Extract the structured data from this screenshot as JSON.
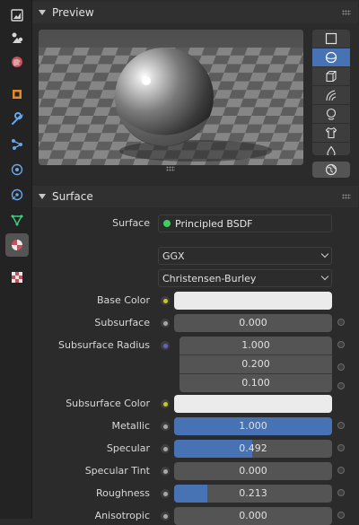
{
  "sidebar": {
    "tabs": [
      {
        "name": "tool-tab",
        "icon": "tool-icon"
      },
      {
        "name": "render-tab",
        "icon": "render-icon"
      },
      {
        "name": "scene-tab",
        "icon": "scene-icon"
      },
      {
        "name": "world-tab",
        "icon": "world-icon"
      },
      {
        "name": "object-tab",
        "icon": "object-icon"
      },
      {
        "name": "modifier-tab",
        "icon": "wrench-icon"
      },
      {
        "name": "particles-tab",
        "icon": "particles-icon"
      },
      {
        "name": "physics-tab",
        "icon": "physics-icon"
      },
      {
        "name": "constraints-tab",
        "icon": "constraint-icon"
      },
      {
        "name": "data-tab",
        "icon": "mesh-data-icon"
      },
      {
        "name": "material-tab",
        "icon": "material-icon",
        "active": true
      },
      {
        "name": "texture-tab",
        "icon": "texture-icon"
      }
    ]
  },
  "preview_panel": {
    "title": "Preview",
    "shapes": [
      "plane-icon",
      "sphere-icon",
      "cube-icon",
      "hair-icon",
      "monkey-icon",
      "cloth-icon",
      "fluid-icon"
    ],
    "active_shape": "sphere-icon",
    "world_button": "world-icon"
  },
  "surface_panel": {
    "title": "Surface",
    "surface_label": "Surface",
    "surface_value": "Principled BSDF",
    "distribution": "GGX",
    "subsurface_method": "Christensen-Burley",
    "base_color_label": "Base Color",
    "base_color": "#ebebeb",
    "subsurface_label": "Subsurface",
    "subsurface_value": "0.000",
    "subsurface_radius_label": "Subsurface Radius",
    "subsurface_radius": [
      "1.000",
      "0.200",
      "0.100"
    ],
    "subsurface_color_label": "Subsurface Color",
    "subsurface_color": "#ebebeb",
    "metallic_label": "Metallic",
    "metallic_value": "1.000",
    "metallic_fraction": 1.0,
    "specular_label": "Specular",
    "specular_value": "0.492",
    "specular_fraction": 0.492,
    "specular_tint_label": "Specular Tint",
    "specular_tint_value": "0.000",
    "roughness_label": "Roughness",
    "roughness_value": "0.213",
    "roughness_fraction": 0.213,
    "anisotropic_label": "Anisotropic",
    "anisotropic_value": "0.000"
  },
  "colors": {
    "accent": "#4772b3",
    "socket_yellow": "#c7c729",
    "socket_purple": "#6363c7",
    "socket_gray": "#a7a7a7",
    "shader_green": "#3fcf5f"
  }
}
